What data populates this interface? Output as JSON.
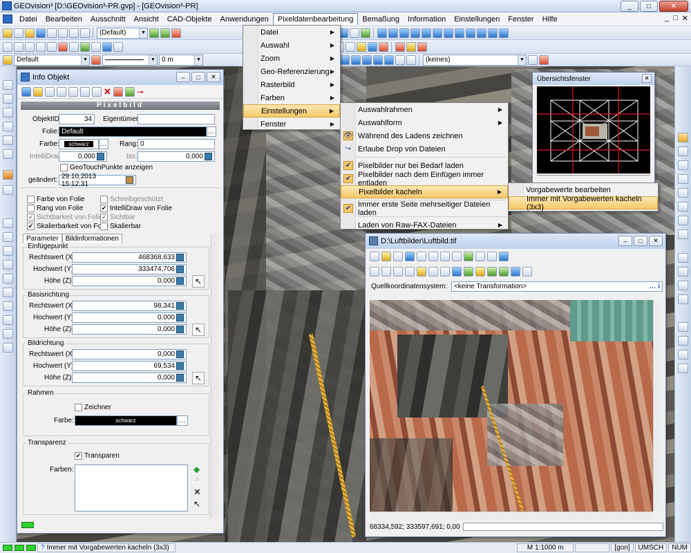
{
  "window": {
    "title": "GEOvision³  [D:\\GEOvision³-PR.gvp] - [GEOvision³-PR]",
    "buttons": [
      "_",
      "□",
      "✕"
    ]
  },
  "menubar": {
    "items": [
      "Datei",
      "Bearbeiten",
      "Ausschnitt",
      "Ansicht",
      "CAD-Objekte",
      "Anwendungen",
      "Pixeldatenbearbeitung",
      "Bemaßung",
      "Information",
      "Einstellungen",
      "Fenster",
      "Hilfe"
    ],
    "mdi_controls": [
      "_",
      "□",
      "✕"
    ]
  },
  "toolbar1": {
    "style_combo": "(Default)"
  },
  "toolbar3": {
    "layer_combo": "Default",
    "width_combo": "0 m",
    "keines_combo": "(keines)"
  },
  "pixel_menu": {
    "items": [
      {
        "label": "Datei"
      },
      {
        "label": "Auswahl"
      },
      {
        "label": "Zoom"
      },
      {
        "label": "Geo-Referenzierung"
      },
      {
        "label": "Rasterbild"
      },
      {
        "label": "Farben"
      },
      {
        "label": "Einstellungen"
      },
      {
        "label": "Fenster"
      }
    ]
  },
  "settings_menu": {
    "items": [
      "Auswahlrahmen",
      "Auswahlform",
      "Während des Ladens zeichnen",
      "Erlaube Drop von Dateien",
      "Pixelbilder nur bei Bedarf laden",
      "Pixelbilder nach dem Einfügen immer entladen",
      "Pixelbilder kacheln",
      "Immer erste Seite mehrseitiger Dateien laden",
      "Laden von Raw-FAX-Dateien"
    ]
  },
  "kacheln_menu": {
    "items": [
      "Vorgabewerte bearbeiten",
      "Immer mit Vorgabewerten kacheln (3x3)"
    ]
  },
  "info_panel": {
    "title": "Info Objekt",
    "section": "Pixelbild",
    "objekt_id_label": "ObjektID:",
    "objekt_id": "34",
    "eigentuemer_label": "Eigentümer:",
    "folie_label": "Folie:",
    "folie": "Default",
    "farbe_label": "Farbe:",
    "farbe": "schwarz",
    "rang_label": "Rang:",
    "rang": "0",
    "intellidraw_label": "IntelliDraw:",
    "intellidraw": "0,000",
    "bis_label": "bis:",
    "bis": "0,000",
    "geotouch": "GeoTouchPunkte anzeigen",
    "geaendert_label": "geändert:",
    "geaendert": "29.10.2013 15:12:31",
    "checks": [
      "Farbe von Folie",
      "Schreibgeschützt",
      "Rang von Folie",
      "IntelliDraw von Folie",
      "Sichtbarkeit von Folie",
      "Sichtbar",
      "Skalierbarkeit von Folie",
      "Skalierbar"
    ],
    "tabs": [
      "Parameter",
      "Bildinformationen"
    ],
    "einfuege": {
      "title": "Einfügepunkt",
      "rechts_label": "Rechtswert (X):",
      "rechts": "468368,633",
      "hoch_label": "Hochwert (Y):",
      "hoch": "333474,706",
      "hoehe_label": "Höhe (Z):",
      "hoehe": "0,000"
    },
    "basis": {
      "title": "Basisrichtung",
      "rechts_label": "Rechtswert (X):",
      "rechts": "98,341",
      "hoch_label": "Hochwert (Y):",
      "hoch": "0,000",
      "hoehe_label": "Höhe (Z):",
      "hoehe": "0,000"
    },
    "bild": {
      "title": "Bildrichtung",
      "rechts_label": "Rechtswert (X):",
      "rechts": "0,000",
      "hoch_label": "Hochwert (Y):",
      "hoch": "69,534",
      "hoehe_label": "Höhe (Z):",
      "hoehe": "0,000"
    },
    "rahmen": {
      "title": "Rahmen",
      "zeichner": "Zeichner",
      "farbe_label": "Farbe:",
      "farbe": "schwarz"
    },
    "transparenz": {
      "title": "Transparenz",
      "transparent": "Transparen",
      "farben_label": "Farben:"
    }
  },
  "overview": {
    "title": "Übersichtsfenster"
  },
  "luftbild": {
    "title": "D:\\Luftbilder\\Luftbild.tif",
    "quell_label": "Quellkoordinatensystem:",
    "quell_value": "<keine Transformation>",
    "coords": "68334,592; 333597,691; 0,00"
  },
  "status": {
    "message": "Immer mit Vorgabewerten kacheln (3x3)",
    "scale": "M 1:1000 m",
    "gon": "[gon]",
    "umsch": "UMSCH",
    "num": "NUM"
  }
}
